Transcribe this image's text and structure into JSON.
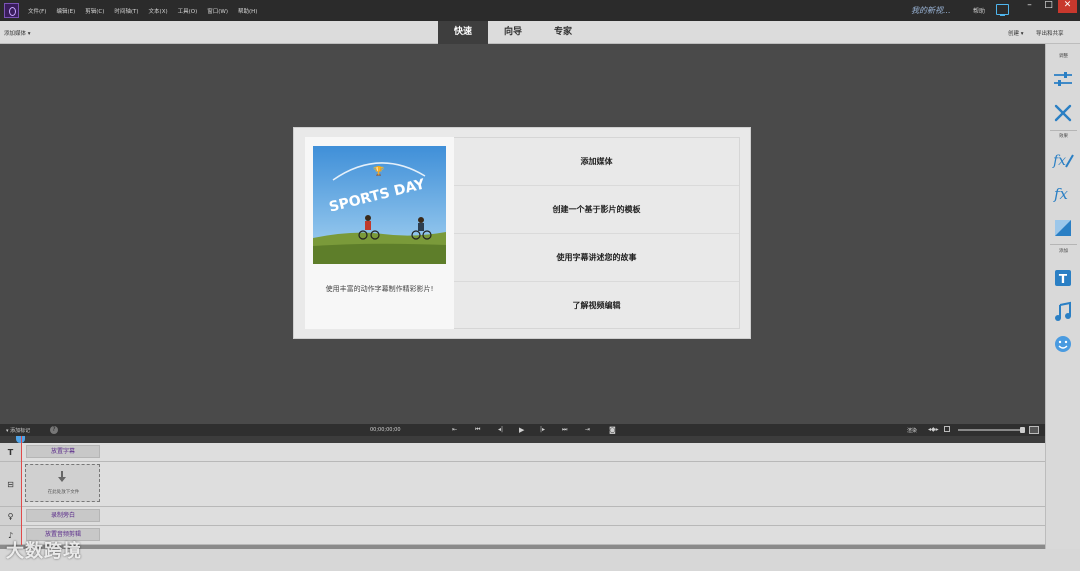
{
  "menu": [
    "文件(F)",
    "编辑(E)",
    "剪辑(C)",
    "时间轴(T)",
    "文本(X)",
    "工具(O)",
    "窗口(W)",
    "帮助(H)"
  ],
  "title": {
    "project_name": "我的新视...",
    "help": "帮助"
  },
  "modebar": {
    "add_media": "添加媒体 ▾",
    "tabs": [
      "快速",
      "向导",
      "专家"
    ],
    "create": "创建 ▾",
    "export": "导出和共享"
  },
  "welcome": {
    "thumbnail_text": "SPORTS DAY",
    "caption": "使用丰富的动作字幕制作精彩影片!",
    "items": [
      "添加媒体",
      "创建一个基于影片的模板",
      "使用字幕讲述您的故事",
      "了解视频编辑"
    ]
  },
  "rightpanel": {
    "label_adjust": "调整",
    "label_effects": "效果",
    "label_add": "添加"
  },
  "timeline": {
    "add_marker": "▾ 添加标记",
    "timecode": "00;00;00;00",
    "render": "渲染",
    "tracks": {
      "title": "放置字幕",
      "drop": "在此处放下文件",
      "narration": "录制旁白",
      "audio": "放置音频剪辑"
    }
  },
  "watermark": "大数跨境",
  "colors": {
    "accent": "#4fb6ee",
    "track_text": "#5a2a8a",
    "dark_bg": "#4a4a4a"
  }
}
